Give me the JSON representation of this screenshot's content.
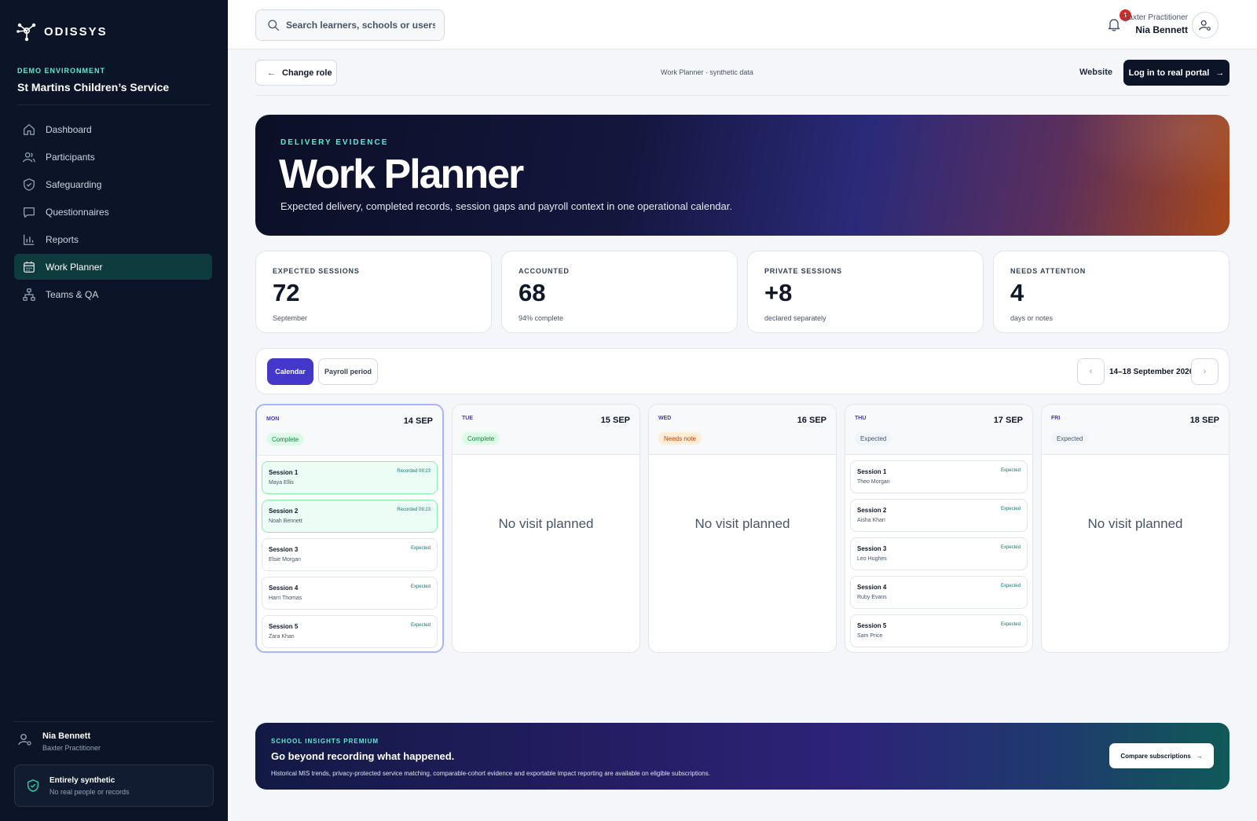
{
  "brand": {
    "name": "ODISSYS"
  },
  "sidebar": {
    "env_label": "DEMO ENVIRONMENT",
    "env_name": "St Martins Children’s Service",
    "items": [
      {
        "label": "Dashboard",
        "icon": "home-icon"
      },
      {
        "label": "Participants",
        "icon": "users-icon"
      },
      {
        "label": "Safeguarding",
        "icon": "shield-icon"
      },
      {
        "label": "Questionnaires",
        "icon": "message-icon"
      },
      {
        "label": "Reports",
        "icon": "bar-chart-icon"
      },
      {
        "label": "Work Planner",
        "icon": "calendar-icon",
        "active": true
      },
      {
        "label": "Teams & QA",
        "icon": "hierarchy-icon"
      }
    ],
    "user": {
      "name": "Nia Bennett",
      "role": "Baxter Practitioner"
    },
    "synthetic": {
      "title": "Entirely synthetic",
      "subtitle": "No real people or records"
    }
  },
  "topbar": {
    "search_placeholder": "Search learners, schools or users…",
    "notification_count": "1",
    "user_role": "Baxter Practitioner",
    "user_name": "Nia Bennett"
  },
  "subheader": {
    "change_role": "Change role",
    "breadcrumb": "Work Planner · synthetic data",
    "website": "Website",
    "login": "Log in to real portal"
  },
  "hero": {
    "kicker": "DELIVERY EVIDENCE",
    "title": "Work Planner",
    "subtitle": "Expected delivery, completed records, session gaps and payroll context in one operational calendar."
  },
  "stats": [
    {
      "label": "EXPECTED SESSIONS",
      "value": "72",
      "sub": "September"
    },
    {
      "label": "ACCOUNTED",
      "value": "68",
      "sub": "94% complete"
    },
    {
      "label": "PRIVATE SESSIONS",
      "value": "+8",
      "sub": "declared separately"
    },
    {
      "label": "NEEDS ATTENTION",
      "value": "4",
      "sub": "days or notes"
    }
  ],
  "toolbar": {
    "tab_calendar": "Calendar",
    "tab_payroll": "Payroll period",
    "prev": "‹",
    "next": "›",
    "week_range": "14–18 September 2026"
  },
  "days": [
    {
      "dow": "MON",
      "date": "14 SEP",
      "status": "Complete",
      "status_type": "complete",
      "sessions": [
        {
          "title": "Session 1",
          "person": "Maya Ellis",
          "status": "Recorded 09:23",
          "recorded": true
        },
        {
          "title": "Session 2",
          "person": "Noah Bennett",
          "status": "Recorded 09:23",
          "recorded": true
        },
        {
          "title": "Session 3",
          "person": "Elsie Morgan",
          "status": "Expected",
          "recorded": false
        },
        {
          "title": "Session 4",
          "person": "Harri Thomas",
          "status": "Expected",
          "recorded": false
        },
        {
          "title": "Session 5",
          "person": "Zara Khan",
          "status": "Expected",
          "recorded": false
        }
      ]
    },
    {
      "dow": "TUE",
      "date": "15 SEP",
      "status": "Complete",
      "status_type": "complete",
      "empty_text": "No visit planned",
      "sessions": []
    },
    {
      "dow": "WED",
      "date": "16 SEP",
      "status": "Needs note",
      "status_type": "note",
      "empty_text": "No visit planned",
      "sessions": []
    },
    {
      "dow": "THU",
      "date": "17 SEP",
      "status": "Expected",
      "status_type": "expected",
      "sessions": [
        {
          "title": "Session 1",
          "person": "Theo Morgan",
          "status": "Expected",
          "recorded": false
        },
        {
          "title": "Session 2",
          "person": "Aisha Khan",
          "status": "Expected",
          "recorded": false
        },
        {
          "title": "Session 3",
          "person": "Leo Hughes",
          "status": "Expected",
          "recorded": false
        },
        {
          "title": "Session 4",
          "person": "Ruby Evans",
          "status": "Expected",
          "recorded": false
        },
        {
          "title": "Session 5",
          "person": "Sam Price",
          "status": "Expected",
          "recorded": false
        }
      ]
    },
    {
      "dow": "FRI",
      "date": "18 SEP",
      "status": "Expected",
      "status_type": "expected",
      "empty_text": "No visit planned",
      "sessions": []
    }
  ],
  "promo": {
    "kicker": "SCHOOL INSIGHTS PREMIUM",
    "title": "Go beyond recording what happened.",
    "subtitle": "Historical MIS trends, privacy-protected service matching, comparable-cohort evidence and exportable impact reporting are available on eligible subscriptions.",
    "button": "Compare subscriptions"
  }
}
